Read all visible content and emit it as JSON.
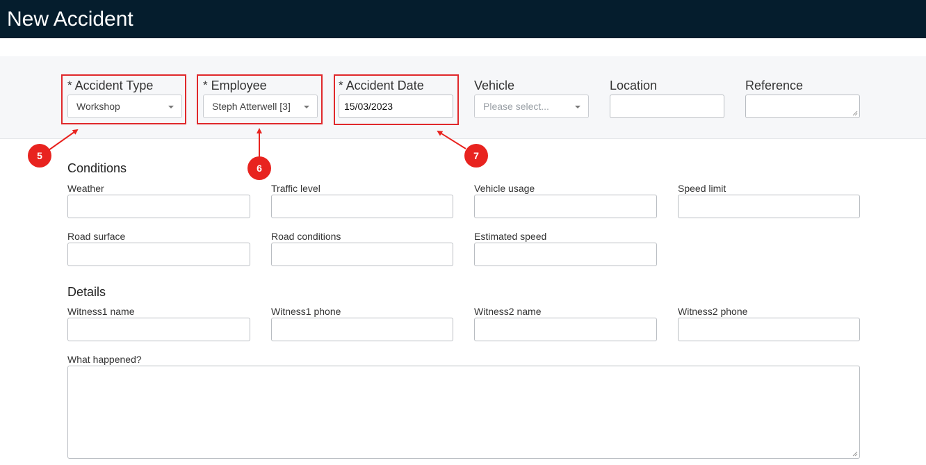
{
  "window": {
    "title": "New Accident"
  },
  "header_fields": {
    "accident_type": {
      "required_marker": "*",
      "label": "Accident Type",
      "value": "Workshop"
    },
    "employee": {
      "required_marker": "*",
      "label": "Employee",
      "value": "Steph Atterwell [3]"
    },
    "accident_date": {
      "required_marker": "*",
      "label": "Accident Date",
      "value": "15/03/2023"
    },
    "vehicle": {
      "label": "Vehicle",
      "placeholder": "Please select..."
    },
    "location": {
      "label": "Location",
      "value": ""
    },
    "reference": {
      "label": "Reference",
      "value": ""
    }
  },
  "conditions": {
    "title": "Conditions",
    "weather": {
      "label": "Weather",
      "value": ""
    },
    "traffic_level": {
      "label": "Traffic level",
      "value": ""
    },
    "vehicle_usage": {
      "label": "Vehicle usage",
      "value": ""
    },
    "speed_limit": {
      "label": "Speed limit",
      "value": ""
    },
    "road_surface": {
      "label": "Road surface",
      "value": ""
    },
    "road_conditions": {
      "label": "Road conditions",
      "value": ""
    },
    "estimated_speed": {
      "label": "Estimated speed",
      "value": ""
    }
  },
  "details": {
    "title": "Details",
    "witness1_name": {
      "label": "Witness1 name",
      "value": ""
    },
    "witness1_phone": {
      "label": "Witness1 phone",
      "value": ""
    },
    "witness2_name": {
      "label": "Witness2 name",
      "value": ""
    },
    "witness2_phone": {
      "label": "Witness2 phone",
      "value": ""
    },
    "what_happened": {
      "label": "What happened?",
      "value": ""
    }
  },
  "annotations": {
    "badge_5": "5",
    "badge_6": "6",
    "badge_7": "7"
  },
  "colors": {
    "title_bar": "#051d2d",
    "annotation": "#e8231f",
    "band": "#f6f7f9"
  }
}
